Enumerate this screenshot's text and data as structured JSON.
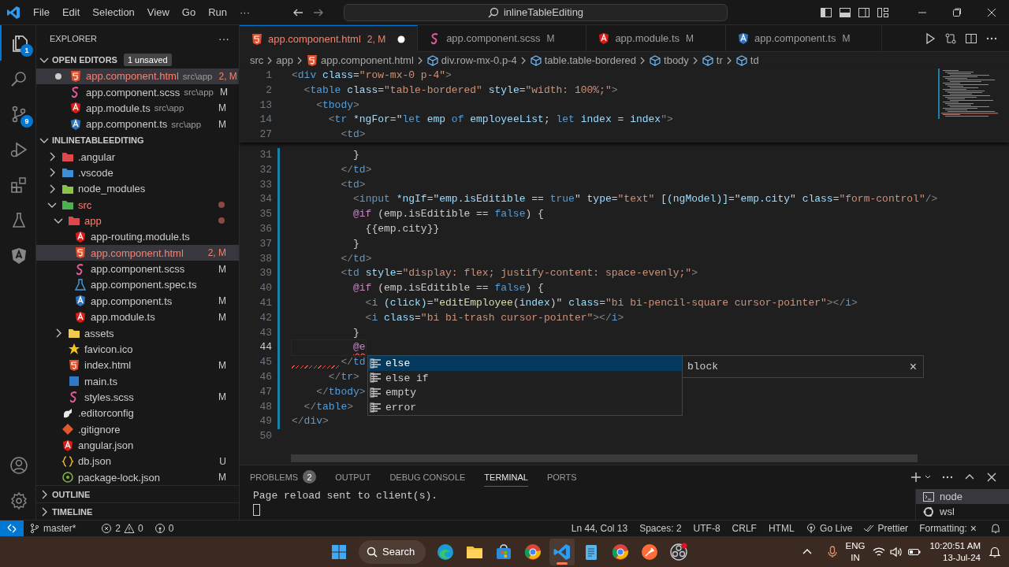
{
  "title_bar": {
    "menu": [
      "File",
      "Edit",
      "Selection",
      "View",
      "Go",
      "Run",
      "···"
    ],
    "command_center": "inlineTableEditing"
  },
  "activity_bar": {
    "items": [
      {
        "kind": "explorer",
        "selected": true,
        "badge": "1"
      },
      {
        "kind": "search",
        "selected": false
      },
      {
        "kind": "source-control",
        "selected": false,
        "badge": "9"
      },
      {
        "kind": "run",
        "selected": false
      },
      {
        "kind": "extensions",
        "selected": false
      },
      {
        "kind": "testing",
        "selected": false
      },
      {
        "kind": "angular",
        "selected": false
      }
    ],
    "bottom": [
      {
        "kind": "account"
      },
      {
        "kind": "settings"
      }
    ]
  },
  "sidebar": {
    "title": "EXPLORER",
    "more": "···",
    "open_editors": {
      "label": "OPEN EDITORS",
      "expanded": true,
      "badge": "1 unsaved",
      "items": [
        {
          "name": "app.component.html",
          "path": "src\\app",
          "status": "2, M",
          "kind": "html",
          "dirty": true,
          "problems": true,
          "selected": true
        },
        {
          "name": "app.component.scss",
          "path": "src\\app",
          "status": "M",
          "kind": "scss",
          "dirty": false,
          "problems": false,
          "selected": false
        },
        {
          "name": "app.module.ts",
          "path": "src\\app",
          "status": "M",
          "kind": "angular",
          "dirty": false,
          "problems": false,
          "selected": false
        },
        {
          "name": "app.component.ts",
          "path": "src\\app",
          "status": "M",
          "kind": "angular-ts",
          "dirty": false,
          "problems": false,
          "selected": false
        }
      ]
    },
    "project": {
      "label": "INLINETABLEEDITING",
      "expanded": true,
      "items": [
        {
          "name": ".angular",
          "kind": "folder",
          "color": "#e0474c",
          "expanded": false,
          "selected": false,
          "problems": false
        },
        {
          "name": ".vscode",
          "kind": "folder",
          "color": "#3d8fd6",
          "expanded": false,
          "selected": false,
          "problems": false
        },
        {
          "name": "node_modules",
          "kind": "folder",
          "color": "#8bc34a",
          "expanded": false,
          "selected": false,
          "problems": false
        },
        {
          "name": "src",
          "kind": "folder",
          "color": "#4caf50",
          "expanded": true,
          "selected": false,
          "problems": true,
          "children": [
            {
              "name": "app",
              "kind": "folder",
              "color": "#e0474c",
              "expanded": true,
              "selected": false,
              "problems": true,
              "children": [
                {
                  "name": "app-routing.module.ts",
                  "kind": "angular",
                  "selected": false,
                  "problems": false
                },
                {
                  "name": "app.component.html",
                  "kind": "html",
                  "status": "2, M",
                  "selected": true,
                  "problems": true
                },
                {
                  "name": "app.component.scss",
                  "kind": "scss",
                  "status": "M",
                  "selected": false,
                  "problems": false
                },
                {
                  "name": "app.component.spec.ts",
                  "kind": "spec",
                  "selected": false,
                  "problems": false
                },
                {
                  "name": "app.component.ts",
                  "kind": "angular-ts",
                  "status": "M",
                  "selected": false,
                  "problems": false
                },
                {
                  "name": "app.module.ts",
                  "kind": "angular",
                  "status": "M",
                  "selected": false,
                  "problems": false
                }
              ]
            },
            {
              "name": "assets",
              "kind": "folder",
              "color": "#f2c94c",
              "expanded": false,
              "selected": false,
              "problems": false
            },
            {
              "name": "favicon.ico",
              "kind": "star",
              "selected": false,
              "problems": false
            },
            {
              "name": "index.html",
              "kind": "html",
              "status": "M",
              "selected": false,
              "problems": false
            },
            {
              "name": "main.ts",
              "kind": "ts",
              "selected": false,
              "problems": false
            },
            {
              "name": "styles.scss",
              "kind": "scss",
              "status": "M",
              "selected": false,
              "problems": false
            }
          ]
        },
        {
          "name": ".editorconfig",
          "kind": "config",
          "selected": false,
          "problems": false
        },
        {
          "name": ".gitignore",
          "kind": "git",
          "selected": false,
          "problems": false
        },
        {
          "name": "angular.json",
          "kind": "angular",
          "selected": false,
          "problems": false
        },
        {
          "name": "db.json",
          "kind": "json",
          "status": "U",
          "selected": false,
          "problems": false
        },
        {
          "name": "package-lock.json",
          "kind": "npm",
          "status": "M",
          "selected": false,
          "problems": false
        }
      ]
    },
    "sections": [
      {
        "label": "OUTLINE",
        "expanded": false
      },
      {
        "label": "TIMELINE",
        "expanded": false
      }
    ]
  },
  "editor": {
    "tabs": [
      {
        "label": "app.component.html",
        "status": "2, M",
        "kind": "html",
        "dirty": true,
        "problems": true,
        "selected": true
      },
      {
        "label": "app.component.scss",
        "status": "M",
        "kind": "scss",
        "dirty": false,
        "problems": false,
        "selected": false
      },
      {
        "label": "app.module.ts",
        "status": "M",
        "kind": "angular",
        "dirty": false,
        "problems": false,
        "selected": false
      },
      {
        "label": "app.component.ts",
        "status": "M",
        "kind": "angular-ts",
        "dirty": false,
        "problems": false,
        "selected": false
      }
    ],
    "breadcrumbs": [
      {
        "label": "src",
        "kind": "folder"
      },
      {
        "label": "app",
        "kind": "folder"
      },
      {
        "label": "app.component.html",
        "kind": "html"
      },
      {
        "label": "div.row-mx-0.p-4",
        "kind": "element"
      },
      {
        "label": "table.table-bordered",
        "kind": "element"
      },
      {
        "label": "tbody",
        "kind": "element"
      },
      {
        "label": "tr",
        "kind": "element"
      },
      {
        "label": "td",
        "kind": "element"
      }
    ],
    "sticky_lines": [
      {
        "number": "1",
        "tokens": [
          {
            "kind": "p",
            "text": "<"
          },
          {
            "kind": "tag",
            "text": "div"
          },
          {
            "kind": "attr",
            "text": " class"
          },
          {
            "kind": "text",
            "text": "="
          },
          {
            "kind": "str",
            "text": "\"row-mx-0 p-4\""
          },
          {
            "kind": "p",
            "text": ">"
          }
        ]
      },
      {
        "number": "2",
        "tokens": [
          {
            "kind": "p",
            "text": "  <"
          },
          {
            "kind": "tag",
            "text": "table"
          },
          {
            "kind": "attr",
            "text": " class"
          },
          {
            "kind": "text",
            "text": "="
          },
          {
            "kind": "str",
            "text": "\"table-bordered\""
          },
          {
            "kind": "attr",
            "text": " style"
          },
          {
            "kind": "text",
            "text": "="
          },
          {
            "kind": "str",
            "text": "\"width: 100%;\""
          },
          {
            "kind": "p",
            "text": ">"
          }
        ]
      },
      {
        "number": "13",
        "tokens": [
          {
            "kind": "p",
            "text": "    <"
          },
          {
            "kind": "tag",
            "text": "tbody"
          },
          {
            "kind": "p",
            "text": ">"
          }
        ]
      },
      {
        "number": "14",
        "tokens": [
          {
            "kind": "p",
            "text": "      <"
          },
          {
            "kind": "tag",
            "text": "tr"
          },
          {
            "kind": "attr",
            "text": " *ngFor"
          },
          {
            "kind": "text",
            "text": "=\""
          },
          {
            "kind": "tag",
            "text": "let"
          },
          {
            "kind": "attr",
            "text": " emp "
          },
          {
            "kind": "tag",
            "text": "of"
          },
          {
            "kind": "attr",
            "text": " employeeList"
          },
          {
            "kind": "text",
            "text": "; "
          },
          {
            "kind": "tag",
            "text": "let"
          },
          {
            "kind": "attr",
            "text": " index "
          },
          {
            "kind": "text",
            "text": "= "
          },
          {
            "kind": "attr",
            "text": "index"
          },
          {
            "kind": "p",
            "text": "\">"
          }
        ]
      },
      {
        "number": "27",
        "tokens": [
          {
            "kind": "p",
            "text": "        <"
          },
          {
            "kind": "tag",
            "text": "td"
          },
          {
            "kind": "p",
            "text": ">"
          }
        ]
      }
    ],
    "lines": [
      {
        "number": "31",
        "modified": true,
        "current": false,
        "tokens": [
          {
            "kind": "text",
            "text": "          }"
          }
        ]
      },
      {
        "number": "32",
        "modified": true,
        "current": false,
        "tokens": [
          {
            "kind": "p",
            "text": "        </"
          },
          {
            "kind": "tag",
            "text": "td"
          },
          {
            "kind": "p",
            "text": ">"
          }
        ]
      },
      {
        "number": "33",
        "modified": true,
        "current": false,
        "tokens": [
          {
            "kind": "p",
            "text": "        <"
          },
          {
            "kind": "tag",
            "text": "td"
          },
          {
            "kind": "p",
            "text": ">"
          }
        ]
      },
      {
        "number": "34",
        "modified": true,
        "current": false,
        "tokens": [
          {
            "kind": "p",
            "text": "          <"
          },
          {
            "kind": "tag",
            "text": "input"
          },
          {
            "kind": "attr",
            "text": " *ngIf"
          },
          {
            "kind": "text",
            "text": "=\""
          },
          {
            "kind": "attr",
            "text": "emp.isEditible"
          },
          {
            "kind": "text",
            "text": " == "
          },
          {
            "kind": "tag",
            "text": "true"
          },
          {
            "kind": "text",
            "text": "\""
          },
          {
            "kind": "attr",
            "text": " type"
          },
          {
            "kind": "text",
            "text": "="
          },
          {
            "kind": "str",
            "text": "\"text\""
          },
          {
            "kind": "attr",
            "text": " [(ngModel)]"
          },
          {
            "kind": "text",
            "text": "=\""
          },
          {
            "kind": "attr",
            "text": "emp.city"
          },
          {
            "kind": "text",
            "text": "\""
          },
          {
            "kind": "attr",
            "text": " class"
          },
          {
            "kind": "text",
            "text": "="
          },
          {
            "kind": "str",
            "text": "\"form-control\""
          },
          {
            "kind": "p",
            "text": "/>"
          }
        ]
      },
      {
        "number": "35",
        "modified": true,
        "current": false,
        "tokens": [
          {
            "kind": "kw",
            "text": "          @if"
          },
          {
            "kind": "text",
            "text": " (emp.isEditible == "
          },
          {
            "kind": "tag",
            "text": "false"
          },
          {
            "kind": "text",
            "text": ") {"
          }
        ]
      },
      {
        "number": "36",
        "modified": true,
        "current": false,
        "tokens": [
          {
            "kind": "text",
            "text": "            {{emp.city}}"
          }
        ]
      },
      {
        "number": "37",
        "modified": true,
        "current": false,
        "tokens": [
          {
            "kind": "text",
            "text": "          }"
          }
        ]
      },
      {
        "number": "38",
        "modified": true,
        "current": false,
        "tokens": [
          {
            "kind": "p",
            "text": "        </"
          },
          {
            "kind": "tag",
            "text": "td"
          },
          {
            "kind": "p",
            "text": ">"
          }
        ]
      },
      {
        "number": "39",
        "modified": true,
        "current": false,
        "tokens": [
          {
            "kind": "p",
            "text": "        <"
          },
          {
            "kind": "tag",
            "text": "td"
          },
          {
            "kind": "attr",
            "text": " style"
          },
          {
            "kind": "text",
            "text": "="
          },
          {
            "kind": "str",
            "text": "\"display: flex; justify-content: space-evenly;\""
          },
          {
            "kind": "p",
            "text": ">"
          }
        ]
      },
      {
        "number": "40",
        "modified": true,
        "current": false,
        "tokens": [
          {
            "kind": "kw",
            "text": "          @if"
          },
          {
            "kind": "text",
            "text": " (emp.isEditible == "
          },
          {
            "kind": "tag",
            "text": "false"
          },
          {
            "kind": "text",
            "text": ") {"
          }
        ]
      },
      {
        "number": "41",
        "modified": true,
        "current": false,
        "tokens": [
          {
            "kind": "p",
            "text": "            <"
          },
          {
            "kind": "tag",
            "text": "i"
          },
          {
            "kind": "attr",
            "text": " (click)"
          },
          {
            "kind": "text",
            "text": "=\""
          },
          {
            "kind": "fn",
            "text": "editEmployee"
          },
          {
            "kind": "text",
            "text": "("
          },
          {
            "kind": "attr",
            "text": "index"
          },
          {
            "kind": "text",
            "text": ")\""
          },
          {
            "kind": "attr",
            "text": " class"
          },
          {
            "kind": "text",
            "text": "="
          },
          {
            "kind": "str",
            "text": "\"bi bi-pencil-square cursor-pointer\""
          },
          {
            "kind": "p",
            "text": "></"
          },
          {
            "kind": "tag",
            "text": "i"
          },
          {
            "kind": "p",
            "text": ">"
          }
        ]
      },
      {
        "number": "42",
        "modified": true,
        "current": false,
        "tokens": [
          {
            "kind": "p",
            "text": "            <"
          },
          {
            "kind": "tag",
            "text": "i"
          },
          {
            "kind": "attr",
            "text": " class"
          },
          {
            "kind": "text",
            "text": "="
          },
          {
            "kind": "str",
            "text": "\"bi bi-trash cursor-pointer\""
          },
          {
            "kind": "p",
            "text": "></"
          },
          {
            "kind": "tag",
            "text": "i"
          },
          {
            "kind": "p",
            "text": ">"
          }
        ]
      },
      {
        "number": "43",
        "modified": true,
        "current": false,
        "tokens": [
          {
            "kind": "text",
            "text": "          }"
          }
        ]
      },
      {
        "number": "44",
        "modified": true,
        "current": true,
        "tokens": [
          {
            "kind": "kw",
            "text": "          @e",
            "error": true
          }
        ]
      },
      {
        "number": "45",
        "modified": true,
        "current": false,
        "squiggle": true,
        "tokens": [
          {
            "kind": "p",
            "text": "        </"
          },
          {
            "kind": "tag",
            "text": "td"
          }
        ]
      },
      {
        "number": "46",
        "modified": true,
        "current": false,
        "tokens": [
          {
            "kind": "p",
            "text": "      </"
          },
          {
            "kind": "tag",
            "text": "tr"
          },
          {
            "kind": "p",
            "text": ">"
          }
        ]
      },
      {
        "number": "47",
        "modified": true,
        "current": false,
        "tokens": [
          {
            "kind": "p",
            "text": "    </"
          },
          {
            "kind": "tag",
            "text": "tbody"
          },
          {
            "kind": "p",
            "text": ">"
          }
        ]
      },
      {
        "number": "48",
        "modified": true,
        "current": false,
        "tokens": [
          {
            "kind": "p",
            "text": "  </"
          },
          {
            "kind": "tag",
            "text": "table"
          },
          {
            "kind": "p",
            "text": ">"
          }
        ]
      },
      {
        "number": "49",
        "modified": true,
        "current": false,
        "tokens": [
          {
            "kind": "p",
            "text": "</"
          },
          {
            "kind": "tag",
            "text": "div"
          },
          {
            "kind": "p",
            "text": ">"
          }
        ]
      },
      {
        "number": "50",
        "modified": false,
        "current": false
      }
    ],
    "suggestions": {
      "items": [
        {
          "label": "else",
          "selected": true
        },
        {
          "label": "else if",
          "selected": false
        },
        {
          "label": "empty",
          "selected": false
        },
        {
          "label": "error",
          "selected": false
        }
      ],
      "detail": "block",
      "close": "×"
    }
  },
  "panel": {
    "tabs": [
      {
        "label": "PROBLEMS",
        "badge": "2",
        "selected": false
      },
      {
        "label": "OUTPUT",
        "selected": false
      },
      {
        "label": "DEBUG CONSOLE",
        "selected": false
      },
      {
        "label": "TERMINAL",
        "selected": true
      },
      {
        "label": "PORTS",
        "selected": false
      }
    ],
    "terminal_output": "Page reload sent to client(s).",
    "terminals": [
      {
        "label": "node",
        "kind": "console",
        "selected": true
      },
      {
        "label": "wsl",
        "kind": "linux",
        "selected": false
      }
    ]
  },
  "status_bar": {
    "branch": "master*",
    "errors": "2",
    "warnings": "0",
    "ports": "0",
    "right": [
      "Ln 44, Col 13",
      "Spaces: 2",
      "UTF-8",
      "CRLF",
      "HTML"
    ],
    "go_live": "Go Live",
    "prettier": "Prettier",
    "formatting": "Formatting:",
    "formatting_mark": "×"
  },
  "taskbar": {
    "search": "Search",
    "apps": [
      {
        "kind": "edge",
        "active": false
      },
      {
        "kind": "files",
        "active": false
      },
      {
        "kind": "store",
        "active": false
      },
      {
        "kind": "chrome",
        "active": false
      },
      {
        "kind": "code",
        "active": true
      },
      {
        "kind": "notepad",
        "active": false
      },
      {
        "kind": "chrome",
        "active": false
      },
      {
        "kind": "postman",
        "active": false
      },
      {
        "kind": "obs",
        "active": false
      }
    ],
    "language": "ENG",
    "region": "IN",
    "time": "10:20:51 AM",
    "date": "13-Jul-24"
  }
}
